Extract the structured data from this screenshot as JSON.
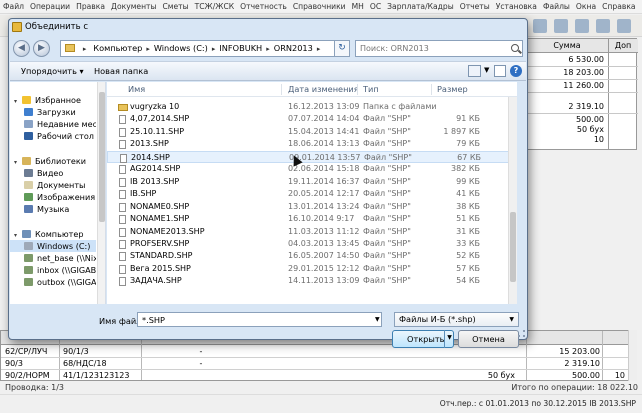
{
  "app": {
    "menu": [
      "Файл",
      "Операции",
      "Правка",
      "Документы",
      "Сметы",
      "ТСЖ/ЖСК",
      "Отчетность",
      "Справочники",
      "МН",
      "ОС",
      "Зарплата/Кадры",
      "Отчеты",
      "Установка",
      "Файлы",
      "Окна",
      "Справка"
    ],
    "grid_headers": {
      "sum": "Сумма",
      "extra": "Доп"
    },
    "grid_values": [
      "6 530.00",
      "18 203.00",
      "11 260.00",
      "2 319.10",
      "500.00",
      "50 бух",
      "10"
    ],
    "bottom_rows": [
      {
        "debit": "62/СР/ЛУЧ",
        "credit": "90/1/3",
        "mid": "-",
        "amount": "15 203.00",
        "extra": ""
      },
      {
        "debit": "90/3",
        "credit": "68/НДС/18",
        "mid": "-",
        "amount": "2 319.10",
        "extra": ""
      },
      {
        "debit": "90/2/НОРМ",
        "credit": "41/1/123123123",
        "mid": "50 бух",
        "amount": "500.00",
        "extra": "10"
      }
    ],
    "status_left": "Проводка: 1/3",
    "status_right": "Итого по операции: 18 022.10",
    "footer": "Отч.пер.: с 01.01.2013 по 30.12.2015   IB 2013.SHP"
  },
  "dialog": {
    "title": "Объединить с",
    "breadcrumb": [
      "Компьютер",
      "Windows (C:)",
      "INFOBUKH",
      "ORN2013"
    ],
    "search_placeholder": "Поиск: ORN2013",
    "organize_label": "Упорядочить ▾",
    "new_folder_label": "Новая папка",
    "nav": [
      {
        "label": "Избранное",
        "icon": "star-icon",
        "level": 0
      },
      {
        "label": "Загрузки",
        "icon": "downloads-icon",
        "level": 1
      },
      {
        "label": "Недавние места",
        "icon": "recent-places-icon",
        "level": 1
      },
      {
        "label": "Рабочий стол",
        "icon": "desktop-icon",
        "level": 1
      },
      {
        "label": "Библиотеки",
        "icon": "libraries-icon",
        "level": 0
      },
      {
        "label": "Видео",
        "icon": "video-icon",
        "level": 1
      },
      {
        "label": "Документы",
        "icon": "documents-icon",
        "level": 1
      },
      {
        "label": "Изображения",
        "icon": "images-icon",
        "level": 1
      },
      {
        "label": "Музыка",
        "icon": "music-icon",
        "level": 1
      },
      {
        "label": "Компьютер",
        "icon": "computer-icon",
        "level": 0
      },
      {
        "label": "Windows (C:)",
        "icon": "drive-icon",
        "level": 1
      },
      {
        "label": "net_base (\\\\Nixor",
        "icon": "network-drive-icon",
        "level": 1
      },
      {
        "label": "inbox (\\\\GIGABY",
        "icon": "network-drive-icon",
        "level": 1
      },
      {
        "label": "outbox (\\\\GIGABY",
        "icon": "network-drive-icon",
        "level": 1
      }
    ],
    "columns": {
      "name": "Имя",
      "date": "Дата изменения",
      "type": "Тип",
      "size": "Размер"
    },
    "files": [
      {
        "name": "vugryzka 10",
        "date": "16.12.2013 13:09",
        "type": "Папка с файлами",
        "size": "",
        "kind": "folder"
      },
      {
        "name": "4,07,2014.SHP",
        "date": "07.07.2014 14:04",
        "type": "Файл \"SHP\"",
        "size": "91 КБ",
        "kind": "file"
      },
      {
        "name": "25.10.11.SHP",
        "date": "15.04.2013 14:41",
        "type": "Файл \"SHP\"",
        "size": "1 897 КБ",
        "kind": "file"
      },
      {
        "name": "2013.SHP",
        "date": "18.06.2014 13:13",
        "type": "Файл \"SHP\"",
        "size": "79 КБ",
        "kind": "file"
      },
      {
        "name": "2014.SHP",
        "date": "09.01.2014 13:57",
        "type": "Файл \"SHP\"",
        "size": "67 КБ",
        "kind": "file"
      },
      {
        "name": "AG2014.SHP",
        "date": "02.06.2014 15:18",
        "type": "Файл \"SHP\"",
        "size": "382 КБ",
        "kind": "file"
      },
      {
        "name": "IB 2013.SHP",
        "date": "19.11.2014 16:37",
        "type": "Файл \"SHP\"",
        "size": "99 КБ",
        "kind": "file"
      },
      {
        "name": "IB.SHP",
        "date": "20.05.2014 12:17",
        "type": "Файл \"SHP\"",
        "size": "41 КБ",
        "kind": "file"
      },
      {
        "name": "NONAME0.SHP",
        "date": "13.01.2014 13:24",
        "type": "Файл \"SHP\"",
        "size": "38 КБ",
        "kind": "file"
      },
      {
        "name": "NONAME1.SHP",
        "date": "16.10.2014 9:17",
        "type": "Файл \"SHP\"",
        "size": "51 КБ",
        "kind": "file"
      },
      {
        "name": "NONAME2013.SHP",
        "date": "11.03.2013 11:12",
        "type": "Файл \"SHP\"",
        "size": "31 КБ",
        "kind": "file"
      },
      {
        "name": "PROFSERV.SHP",
        "date": "04.03.2013 13:45",
        "type": "Файл \"SHP\"",
        "size": "33 КБ",
        "kind": "file"
      },
      {
        "name": "STANDARD.SHP",
        "date": "16.05.2007 14:50",
        "type": "Файл \"SHP\"",
        "size": "52 КБ",
        "kind": "file"
      },
      {
        "name": "Вега 2015.SHP",
        "date": "29.01.2015 12:12",
        "type": "Файл \"SHP\"",
        "size": "57 КБ",
        "kind": "file"
      },
      {
        "name": "ЗАДАЧА.SHP",
        "date": "14.11.2013 13:09",
        "type": "Файл \"SHP\"",
        "size": "54 КБ",
        "kind": "file"
      }
    ],
    "filename_label": "Имя файла:",
    "filename_value": "*.SHP",
    "filetype": "Файлы И-Б (*.shp)",
    "open_label": "Открыть",
    "cancel_label": "Отмена"
  }
}
